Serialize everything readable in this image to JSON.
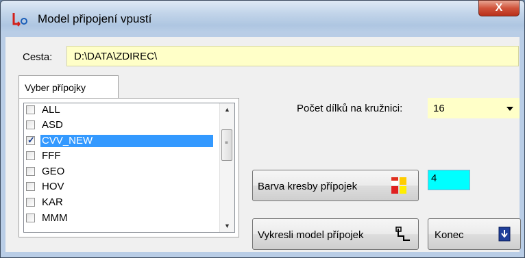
{
  "window": {
    "title": "Model připojení vpustí",
    "close_label": "X"
  },
  "path": {
    "label": "Cesta:",
    "value": "D:\\DATA\\ZDIREC\\"
  },
  "tab": {
    "label": "Vyber přípojky"
  },
  "list": {
    "items": [
      {
        "label": "ALL",
        "checked": false
      },
      {
        "label": "ASD",
        "checked": false
      },
      {
        "label": "CVV_NEW",
        "checked": true,
        "selected": true
      },
      {
        "label": "FFF",
        "checked": false
      },
      {
        "label": "GEO",
        "checked": false
      },
      {
        "label": "HOV",
        "checked": false
      },
      {
        "label": "KAR",
        "checked": false
      },
      {
        "label": "MMM",
        "checked": false
      }
    ]
  },
  "segments": {
    "label": "Počet dílků na kružnici:",
    "value": "16"
  },
  "color": {
    "button_label": "Barva kresby přípojek",
    "value": "4",
    "swatch": "#00ffff"
  },
  "draw": {
    "button_label": "Vykresli model přípojek"
  },
  "exit": {
    "button_label": "Konec"
  }
}
